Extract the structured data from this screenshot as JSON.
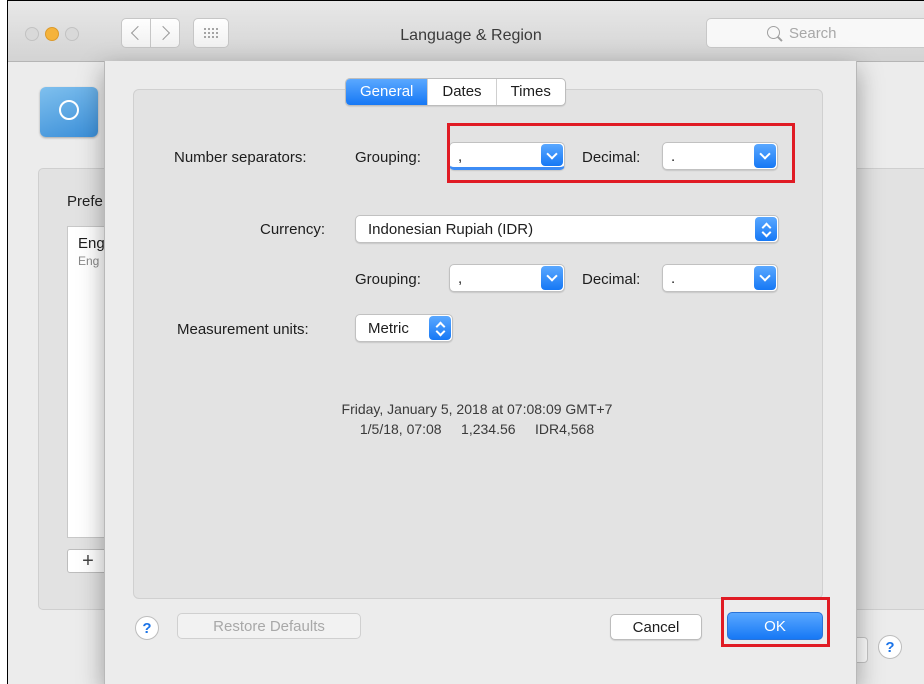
{
  "window": {
    "title": "Language & Region",
    "search_placeholder": "Search"
  },
  "background": {
    "preferred_label": "Prefe",
    "languages": [
      {
        "name": "Eng",
        "sub": "Eng"
      }
    ],
    "add_label": "+",
    "help_label": "?"
  },
  "sheet": {
    "tabs": [
      {
        "label": "General",
        "active": true
      },
      {
        "label": "Dates",
        "active": false
      },
      {
        "label": "Times",
        "active": false
      }
    ],
    "number_separators": {
      "label": "Number separators:",
      "grouping_label": "Grouping:",
      "grouping_value": ",",
      "decimal_label": "Decimal:",
      "decimal_value": "."
    },
    "currency": {
      "label": "Currency:",
      "value": "Indonesian Rupiah (IDR)",
      "grouping_label": "Grouping:",
      "grouping_value": ",",
      "decimal_label": "Decimal:",
      "decimal_value": "."
    },
    "measurement": {
      "label": "Measurement units:",
      "value": "Metric"
    },
    "samples": {
      "long_date": "Friday, January 5, 2018 at 07:08:09 GMT+7",
      "short_line": "1/5/18, 07:08     1,234.56     IDR4,568"
    },
    "buttons": {
      "help": "?",
      "restore_defaults": "Restore Defaults",
      "cancel": "Cancel",
      "ok": "OK"
    }
  },
  "colors": {
    "accent": "#1678f5",
    "highlight": "#e01b24"
  }
}
